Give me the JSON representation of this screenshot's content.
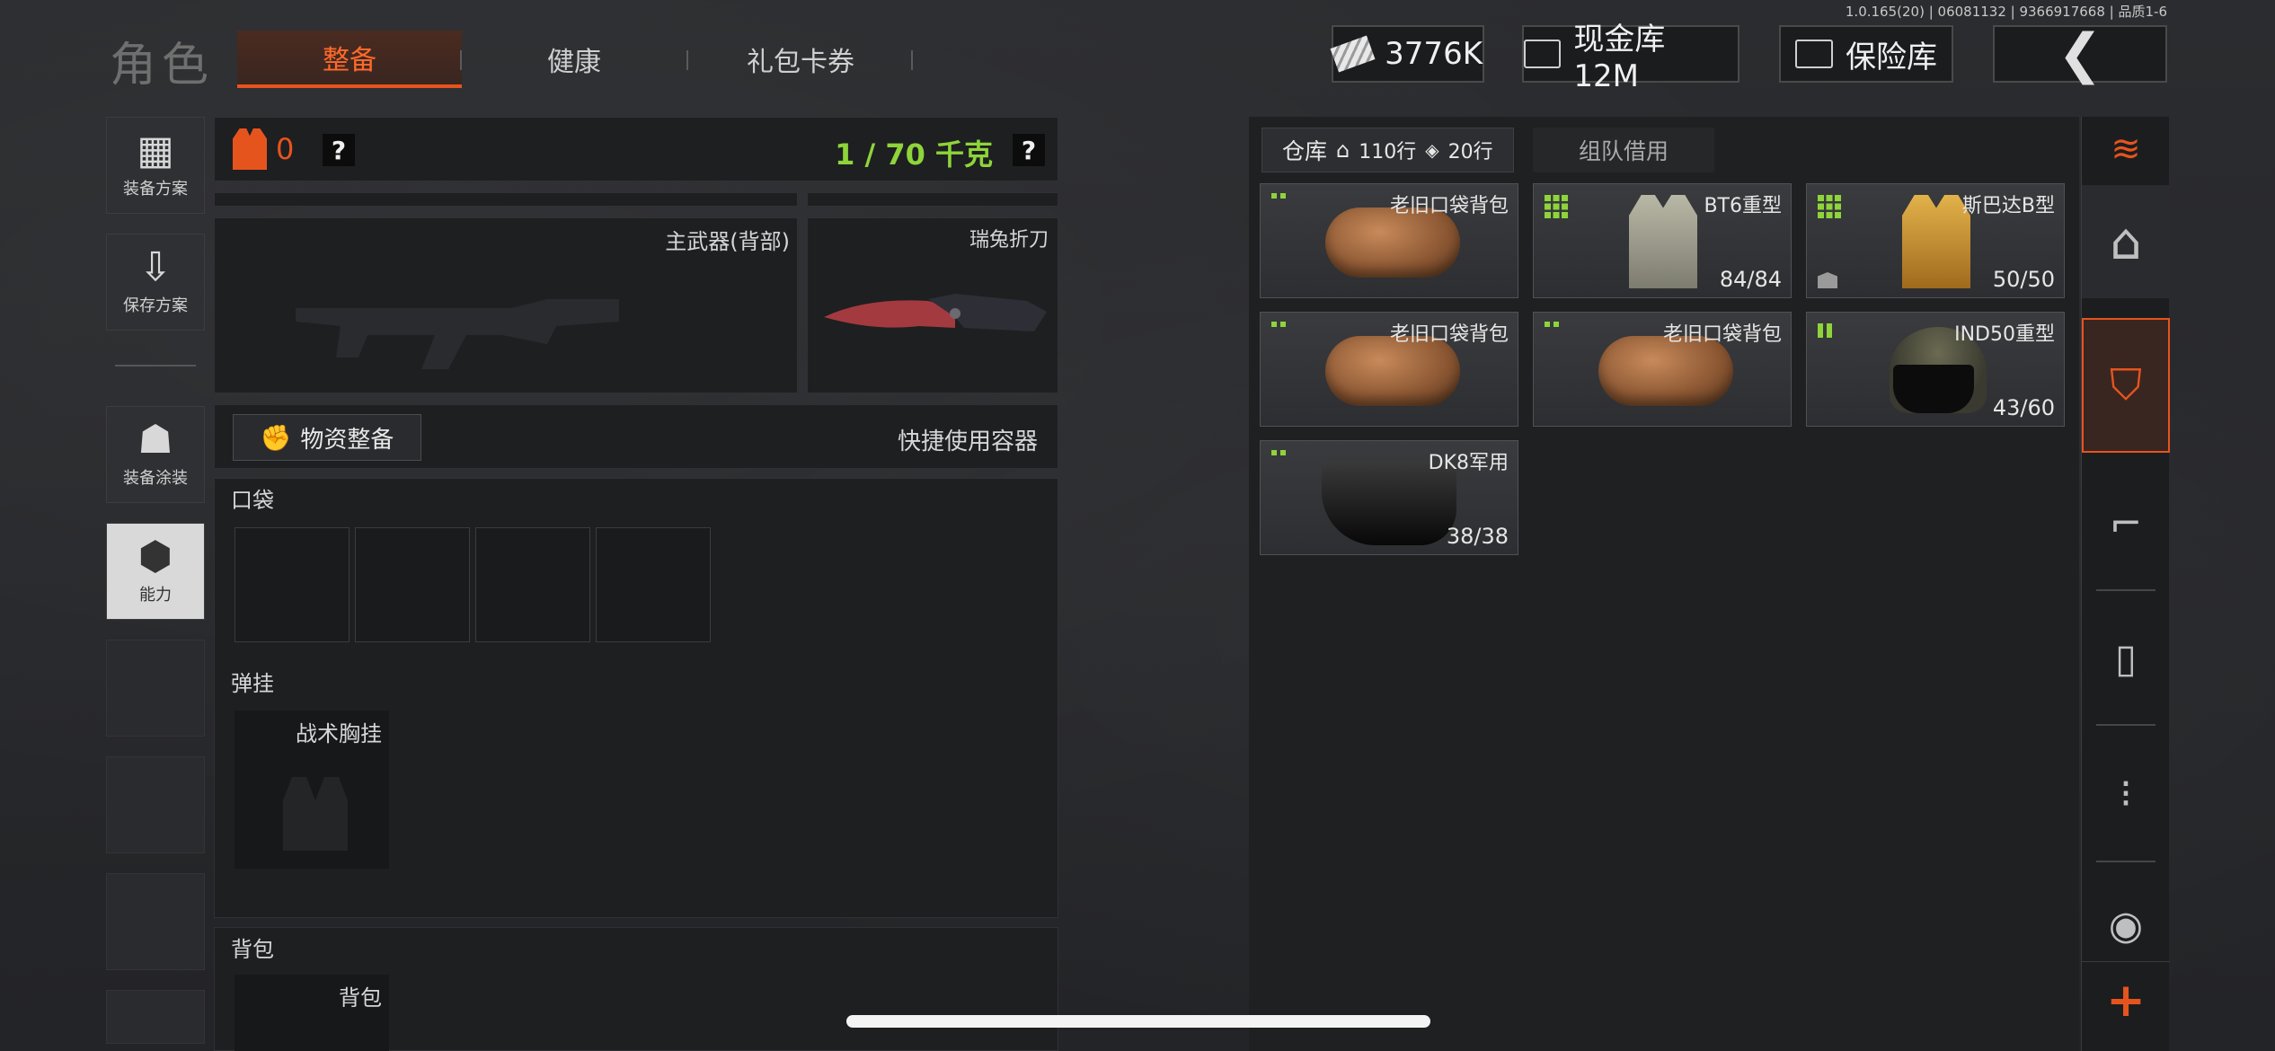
{
  "version": "1.0.165(20) | 06081132 | 9366917668 | 品质1-6",
  "header": {
    "title": "角色",
    "tabs": [
      {
        "label": "整备",
        "active": true
      },
      {
        "label": "健康",
        "active": false
      },
      {
        "label": "礼包卡券",
        "active": false
      }
    ],
    "cash": "3776K",
    "cash_vault": "现金库 12M",
    "safe": "保险库"
  },
  "sidebar": {
    "items": [
      {
        "label": "装备方案",
        "icon": "vest-icon"
      },
      {
        "label": "保存方案",
        "icon": "download-icon"
      },
      {
        "label": "装备涂装",
        "icon": "helmet-icon"
      },
      {
        "label": "能力",
        "icon": "ability-icon",
        "active": true
      }
    ]
  },
  "loadout": {
    "armor_value": "0",
    "help": "?",
    "weight": "1 / 70 千克",
    "primary_weapon_label": "主武器(背部)",
    "knife_label": "瑞兔折刀",
    "supplies_button": "物资整备",
    "quick_container": "快捷使用容器",
    "pocket_label": "口袋",
    "rig_section_label": "弹挂",
    "rig_slot_label": "战术胸挂",
    "backpack_section_label": "背包",
    "backpack_slot_label": "背包"
  },
  "warehouse": {
    "tab_label": "仓库",
    "home_rows": "110行",
    "ticket_rows": "20行",
    "team_tab": "组队借用",
    "items": [
      {
        "name": "老旧口袋背包",
        "durability": "",
        "kind": "bag",
        "size": "2"
      },
      {
        "name": "BT6重型",
        "durability": "84/84",
        "kind": "vest-gray",
        "size": "9"
      },
      {
        "name": "斯巴达B型",
        "durability": "50/50",
        "kind": "vest-gold",
        "size": "9"
      },
      {
        "name": "老旧口袋背包",
        "durability": "",
        "kind": "bag",
        "size": "2"
      },
      {
        "name": "老旧口袋背包",
        "durability": "",
        "kind": "bag",
        "size": "2"
      },
      {
        "name": "IND50重型",
        "durability": "43/60",
        "kind": "helmet",
        "size": "4"
      },
      {
        "name": "DK8军用",
        "durability": "38/38",
        "kind": "visor",
        "size": "2"
      }
    ]
  },
  "colors": {
    "accent": "#e6541e",
    "weight_green": "#8ed43a"
  }
}
